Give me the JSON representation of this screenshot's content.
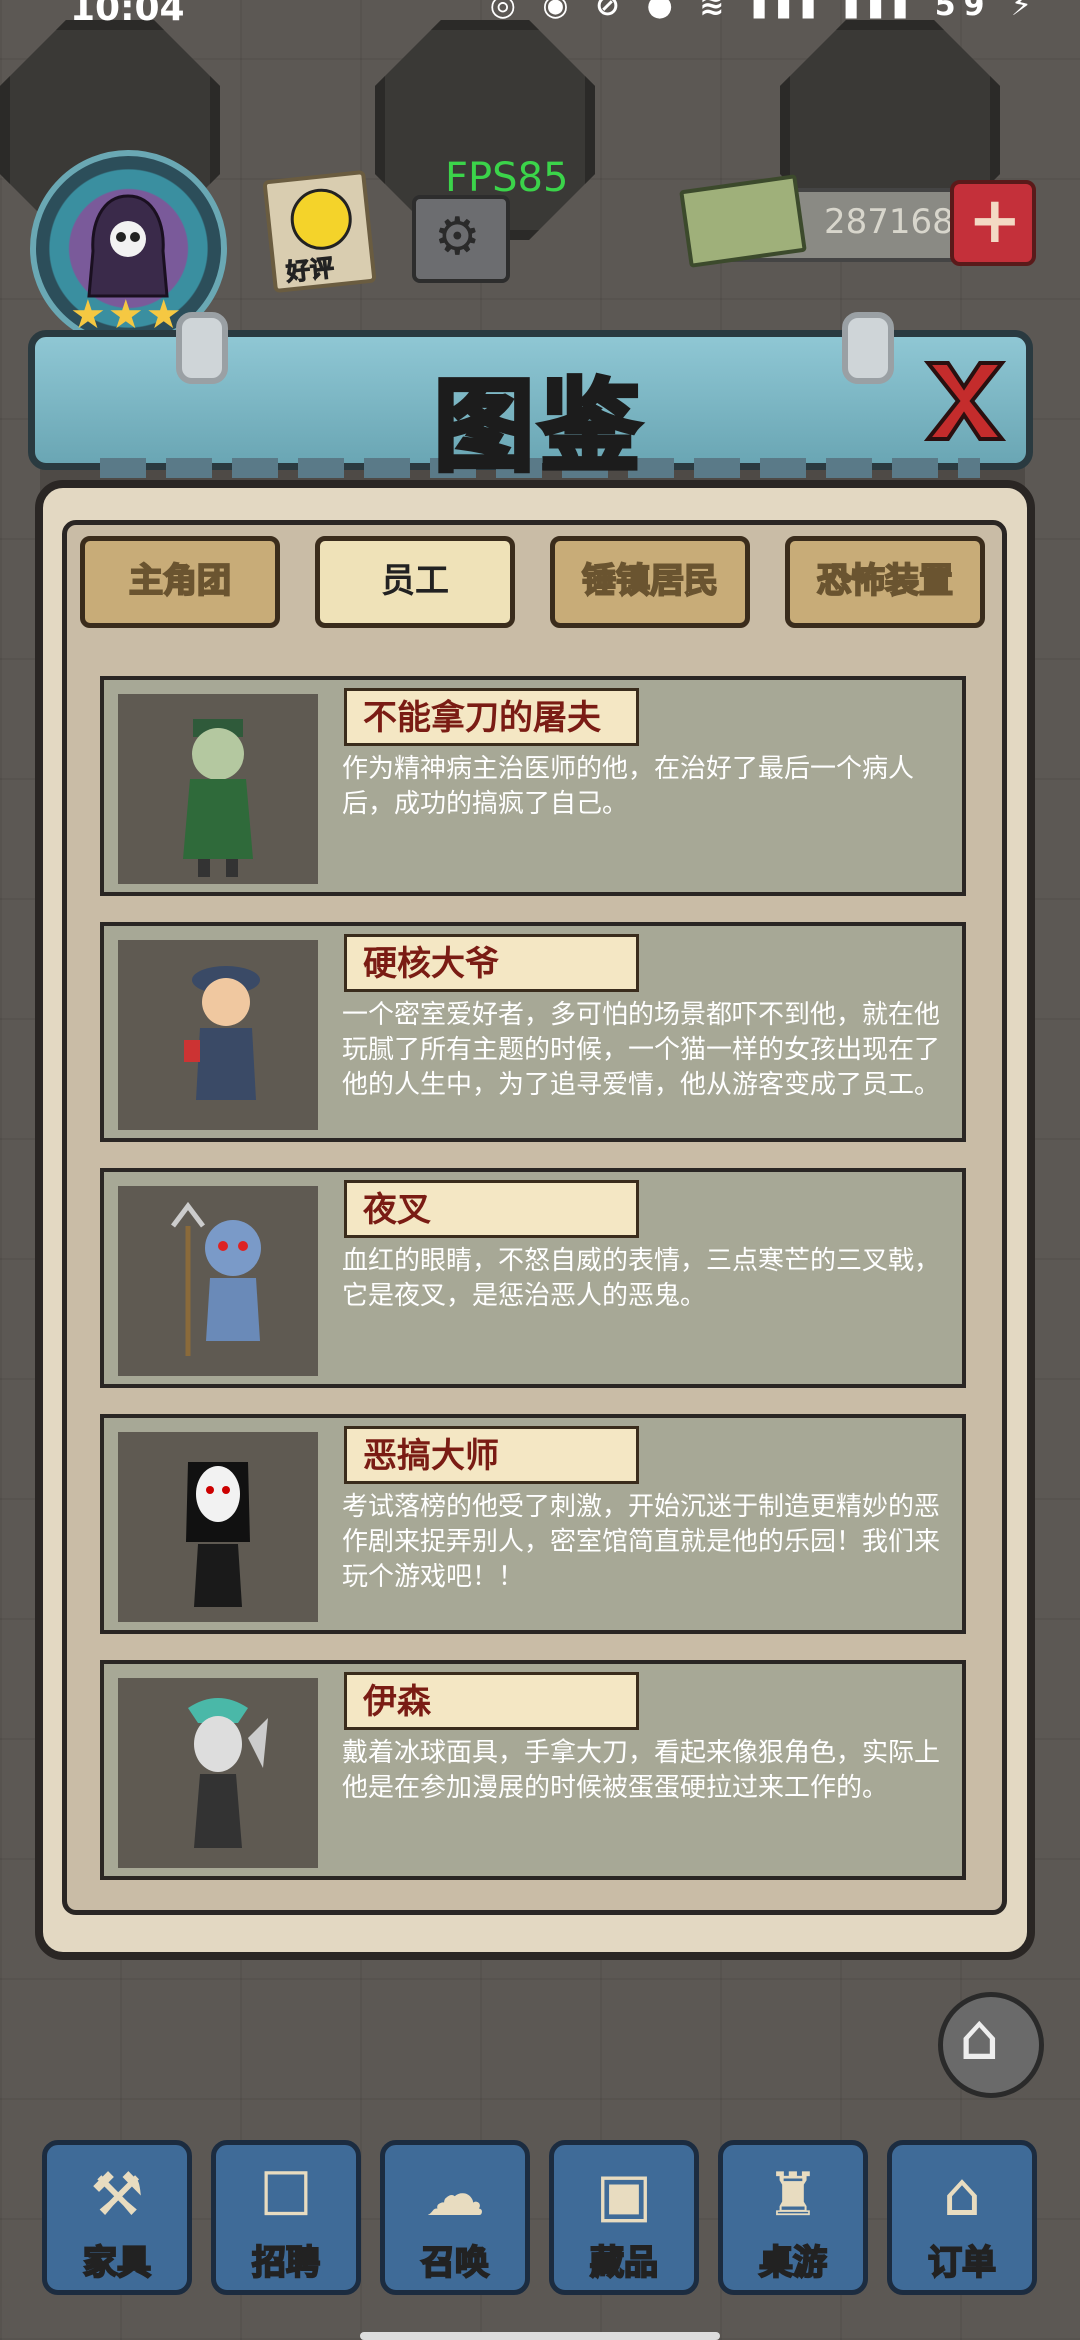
{
  "status_bar": {
    "time": "10:04",
    "battery": "59"
  },
  "hud": {
    "review_label": "好评",
    "fps": "FPS85",
    "money": "287168",
    "add_money_symbol": "+",
    "stars": "★★★"
  },
  "modal": {
    "title": "图鉴",
    "close_symbol": "X",
    "tabs": [
      {
        "label": "主角团",
        "active": false
      },
      {
        "label": "员工",
        "active": true
      },
      {
        "label": "锤镇居民",
        "active": false
      },
      {
        "label": "恐怖装置",
        "active": false
      }
    ],
    "entries": [
      {
        "name": "不能拿刀的屠夫",
        "description": "作为精神病主治医师的他，在治好了最后一个病人后，成功的搞疯了自己。"
      },
      {
        "name": "硬核大爷",
        "description": "一个密室爱好者，多可怕的场景都吓不到他，就在他玩腻了所有主题的时候，一个猫一样的女孩出现在了他的人生中，为了追寻爱情，他从游客变成了员工。"
      },
      {
        "name": "夜叉",
        "description": "血红的眼睛，不怒自威的表情，三点寒芒的三叉戟，它是夜叉，是惩治恶人的恶鬼。"
      },
      {
        "name": "恶搞大师",
        "description": "考试落榜的他受了刺激，开始沉迷于制造更精妙的恶作剧来捉弄别人，密室馆简直就是他的乐园！我们来玩个游戏吧！！"
      },
      {
        "name": "伊森",
        "description": "戴着冰球面具，手拿大刀，看起来像狠角色，实际上他是在参加漫展的时候被蛋蛋硬拉过来工作的。"
      }
    ]
  },
  "bottom_nav": [
    {
      "label": "家具",
      "icon": "hammer-icon"
    },
    {
      "label": "招聘",
      "icon": "clipboard-icon"
    },
    {
      "label": "召唤",
      "icon": "ghost-icon"
    },
    {
      "label": "藏品",
      "icon": "safe-icon"
    },
    {
      "label": "桌游",
      "icon": "chess-icon"
    },
    {
      "label": "订单",
      "icon": "bat-box-icon"
    }
  ]
}
